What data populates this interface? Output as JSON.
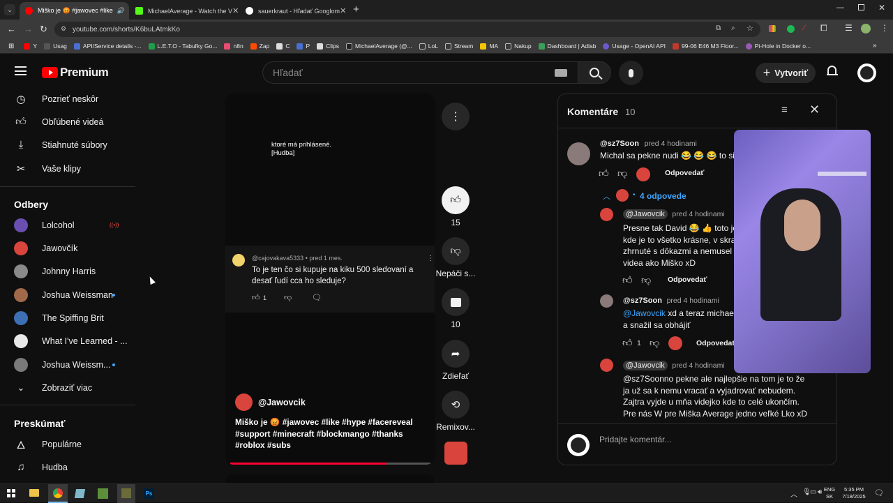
{
  "browser": {
    "tabs": [
      {
        "label": "Miško je 😡 #jawovec #like",
        "active": true
      },
      {
        "label": "MichaelAverage - Watch the V",
        "active": false
      },
      {
        "label": "sauerkraut - Hľadať Googlom",
        "active": false
      }
    ],
    "url": "youtube.com/shorts/K6buLAtmkKo",
    "bookmarks": [
      "Y",
      "Usag",
      "API/Service details -...",
      "L.E.T.O - Tabuľky Go...",
      "n8n",
      "Zap",
      "C",
      "P",
      "Clips",
      "MichaelAverage (@...",
      "LoL",
      "Stream",
      "MA",
      "Nakup",
      "Dashboard | Adlab",
      "Usage - OpenAI API",
      "99-06 E46 M3 Floor...",
      "Pi-Hole in Docker o..."
    ]
  },
  "header": {
    "logo": "Premium",
    "search_placeholder": "Hľadať",
    "create_label": "Vytvoriť"
  },
  "sidebar": {
    "items": [
      {
        "label": "Pozrieť neskôr",
        "icon": "clock-icon"
      },
      {
        "label": "Obľúbené videá",
        "icon": "thumb-up-icon"
      },
      {
        "label": "Stiahnuté súbory",
        "icon": "download-icon"
      },
      {
        "label": "Vaše klipy",
        "icon": "scissors-icon"
      }
    ],
    "subs_title": "Odbery",
    "subs": [
      {
        "label": "Lolcohol",
        "badge": "live",
        "color": "#6b4fb0"
      },
      {
        "label": "Jawovčík",
        "badge": "",
        "color": "#d9443c"
      },
      {
        "label": "Johnny Harris",
        "badge": "",
        "color": "#8a8a8a"
      },
      {
        "label": "Joshua Weissman",
        "badge": "dot",
        "color": "#a06a4a"
      },
      {
        "label": "The Spiffing Brit",
        "badge": "",
        "color": "#3d6fb4"
      },
      {
        "label": "What I've Learned - ...",
        "badge": "",
        "color": "#e8e8e8"
      },
      {
        "label": "Joshua Weissm...",
        "badge": "dot",
        "color": "#7a7a7a"
      }
    ],
    "show_more": "Zobraziť viac",
    "explore_title": "Preskúmať",
    "explore": [
      {
        "label": "Populárne",
        "icon": "fire-icon"
      },
      {
        "label": "Hudba",
        "icon": "music-note-icon"
      }
    ]
  },
  "player": {
    "caption_line1": "ktoré má prihlásené.",
    "caption_line2": "[Hudba]",
    "comment": {
      "author": "@cajovakava5333",
      "time": "• pred 1 mes.",
      "text": "To je ten čo si kupuje na kiku 500 sledovaní a desať ľudí cca ho sleduje?",
      "likes": "1"
    },
    "channel": "@Jawovcik",
    "description": "Miško je 😡 #jawovec #like #hype #facereveal #support #minecraft #blockmango #thanks #roblox #subs",
    "progress": 0.78
  },
  "actions": {
    "likes": "15",
    "dislike_label": "Nepáči s...",
    "comments": "10",
    "share_label": "Zdieľať",
    "remix_label": "Remixov..."
  },
  "comments_panel": {
    "title": "Komentáre",
    "count": "10",
    "add_placeholder": "Pridajte komentár...",
    "top": {
      "author": "@sz7Soon",
      "time": "pred 4 hodinami",
      "text": "Michal sa pekne nudi 😂 😂 😂 to si z",
      "reply_label": "Odpovedať"
    },
    "replies_toggle": "4 odpovede",
    "replies": [
      {
        "author": "@Jawovcik",
        "time": "pred 4 hodinami",
        "lines": [
          "Presne tak David 😂 👍 toto je",
          "kde je to všetko krásne, v skrat",
          "zhrnuté s dôkazmi a nemusel s",
          "videa ako Miško xD"
        ],
        "likes": "",
        "reply_label": "Odpovedať"
      },
      {
        "author": "@sz7Soon",
        "time": "pred 4 hodinami",
        "mention": "@Jawovcik",
        "lines": [
          "xd a teraz michael",
          "a snažil sa obhájiť"
        ],
        "likes": "1",
        "reply_label": "Odpovedať"
      },
      {
        "author": "@Jawovcik",
        "time": "pred 4 hodinami",
        "lines": [
          "@sz7Soonno pekne ale najlepšie na tom je to že",
          "ja už sa k nemu vracať a vyjadrovať nebudem.",
          "Zajtra vyjde u mňa videjko kde to celé ukončím.",
          "Pre nás W pre Miška Average jedno veľké Lko xD"
        ],
        "likes": "",
        "reply_label": ""
      }
    ]
  },
  "taskbar": {
    "lang1": "ENG",
    "lang2": "SK",
    "time": "5:35 PM",
    "date": "7/18/2025"
  }
}
